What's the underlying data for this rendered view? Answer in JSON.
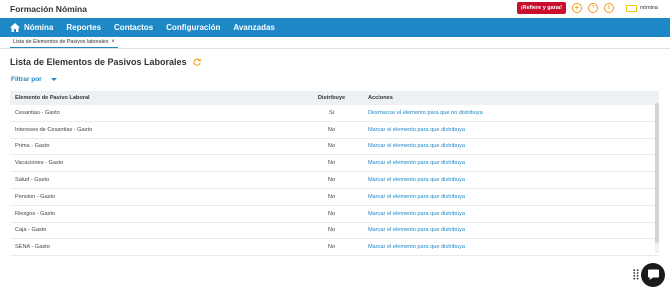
{
  "app": {
    "title": "Formación Nómina"
  },
  "topbar": {
    "refer_label": "¡Refiere y gana!",
    "badge1": "+",
    "badge2": "?",
    "badge3": "6",
    "user_name": "nómina"
  },
  "nav": {
    "items": [
      "Nómina",
      "Reportes",
      "Contactos",
      "Configuración",
      "Avanzadas"
    ]
  },
  "tab": {
    "label": "Lista de Elementos de Pasivos laborales",
    "close": "×"
  },
  "page": {
    "title": "Lista de Elementos de Pasivos Laborales"
  },
  "filter": {
    "label": "Filtrar por"
  },
  "table": {
    "headers": [
      "Elemento de Pasivo Laboral",
      "Distribuye",
      "Acciones"
    ],
    "rows": [
      {
        "name": "Cesantias - Gasto",
        "dist": "Si",
        "action": "Desmarcar el elemento para que no distribuya"
      },
      {
        "name": "Intereses de Cesantias - Gasto",
        "dist": "No",
        "action": "Marcar el elemento para que distribuya"
      },
      {
        "name": "Prima - Gasto",
        "dist": "No",
        "action": "Marcar el elemento para que distribuya"
      },
      {
        "name": "Vacaciones - Gasto",
        "dist": "No",
        "action": "Marcar el elemento para que distribuya"
      },
      {
        "name": "Salud - Gasto",
        "dist": "No",
        "action": "Marcar el elemento para que distribuya"
      },
      {
        "name": "Pension - Gasto",
        "dist": "No",
        "action": "Marcar el elemento para que distribuya"
      },
      {
        "name": "Riesgos - Gasto",
        "dist": "No",
        "action": "Marcar el elemento para que distribuya"
      },
      {
        "name": "Caja - Gasto",
        "dist": "No",
        "action": "Marcar el elemento para que distribuya"
      },
      {
        "name": "SENA - Gasto",
        "dist": "No",
        "action": "Marcar el elemento para que distribuya"
      }
    ]
  },
  "icons": {
    "home": "home-icon",
    "refresh": "refresh-icon",
    "caret": "caret-down-icon",
    "chat": "chat-icon",
    "grid": "grid-dots-icon"
  },
  "colors": {
    "nav": "#1e87c6",
    "refer": "#c8102e",
    "badge": "#f39c12",
    "link": "#1e87c6"
  }
}
